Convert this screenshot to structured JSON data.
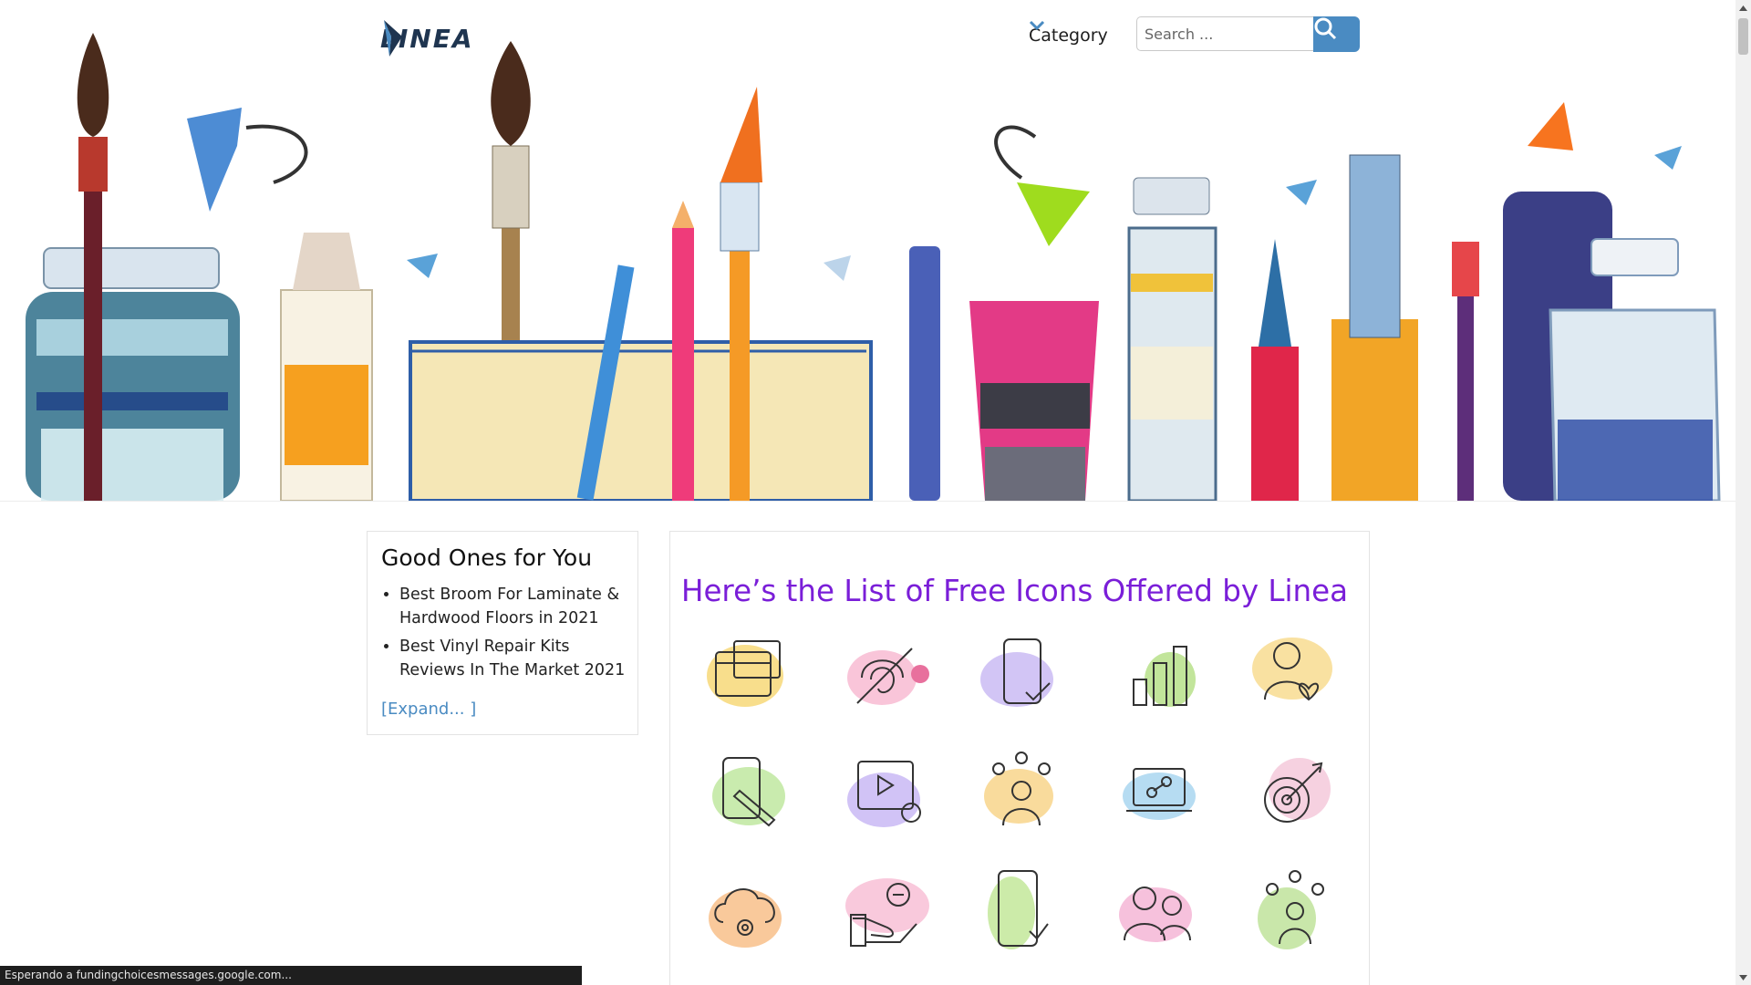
{
  "header": {
    "logo_text": "LINEA",
    "category_label": "Category",
    "search_placeholder": "Search ...",
    "hero_image": "watercolor-art-supplies-banner"
  },
  "sidebar": {
    "title": "Good Ones for You",
    "items": [
      {
        "label": "Best Broom For Laminate & Hardwood Floors in 2021"
      },
      {
        "label": "Best Vinyl Repair Kits Reviews In The Market 2021"
      }
    ],
    "expand_label": "[Expand... ]"
  },
  "main": {
    "title": "Here’s the List of Free Icons Offered by Linea",
    "icons": [
      {
        "name": "browser-window-icon",
        "blob_color": "#f6d365"
      },
      {
        "name": "hidden-fingerprint-icon",
        "blob_color": "#f7b6cf"
      },
      {
        "name": "mobile-checkmark-icon",
        "blob_color": "#c7b6f2"
      },
      {
        "name": "bar-chart-icon",
        "blob_color": "#b7e08a"
      },
      {
        "name": "user-heart-icon",
        "blob_color": "#f8d98a"
      },
      {
        "name": "mobile-edit-icon",
        "blob_color": "#bfe7a0"
      },
      {
        "name": "video-replay-icon",
        "blob_color": "#c9b8f5"
      },
      {
        "name": "team-leader-icon",
        "blob_color": "#f8d58b"
      },
      {
        "name": "laptop-link-icon",
        "blob_color": "#a9d6f0"
      },
      {
        "name": "target-arrow-icon",
        "blob_color": "#f4c6d8"
      },
      {
        "name": "cloud-settings-icon",
        "blob_color": "#f8c08a"
      },
      {
        "name": "hand-coin-icon",
        "blob_color": "#f7bcd3"
      },
      {
        "name": "mobile-download-icon",
        "blob_color": "#c3e89a"
      },
      {
        "name": "users-group-icon",
        "blob_color": "#f4b6d6"
      },
      {
        "name": "team-growth-icon",
        "blob_color": "#bfe39b"
      }
    ]
  },
  "status_bar": {
    "text": "Esperando a fundingchoicesmessages.google.com..."
  },
  "colors": {
    "accent": "#4a8bc2",
    "title_purple": "#7a1ed8",
    "logo_navy": "#1f3550"
  }
}
